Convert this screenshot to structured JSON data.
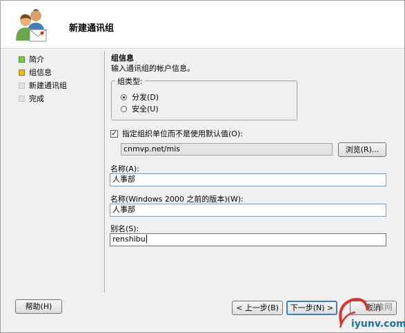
{
  "wizard": {
    "title": "新建通讯组",
    "icon": "users-group-icon"
  },
  "nav": {
    "items": [
      {
        "label": "简介",
        "state": "done"
      },
      {
        "label": "组信息",
        "state": "current"
      },
      {
        "label": "新建通讯组",
        "state": "pending"
      },
      {
        "label": "完成",
        "state": "pending"
      }
    ]
  },
  "section": {
    "title": "组信息",
    "description": "输入通讯组的帐户信息。"
  },
  "group_type": {
    "legend": "组类型:",
    "options": [
      {
        "label": "分发(D)",
        "checked": true
      },
      {
        "label": "安全(U)",
        "checked": false
      }
    ]
  },
  "ou": {
    "checkbox_label": "指定组织单位而不是使用默认值(O):",
    "checked": true,
    "value": "cnmvp.net/mis",
    "browse_label": "浏览(R)..."
  },
  "fields": {
    "name_label": "名称(A):",
    "name_value": "人事部",
    "pre2000_label": "名称(Windows 2000 之前的版本)(W):",
    "pre2000_value": "人事部",
    "alias_label": "别名(S):",
    "alias_value": "renshibu"
  },
  "footer": {
    "help_label": "帮助(H)",
    "back_label": "< 上一步(B)",
    "next_label": "下一步(N) >",
    "cancel_label": "取消"
  },
  "watermark": {
    "text": "iyunv.com",
    "cn_text": "运维网"
  },
  "colors": {
    "window_bg": "#f0f0f0",
    "step_done": "#7ac943",
    "step_current": "#f2b519",
    "step_pending": "#e4e4e4",
    "watermark_red": "#d9342b",
    "watermark_blue": "#1c6ea4"
  }
}
